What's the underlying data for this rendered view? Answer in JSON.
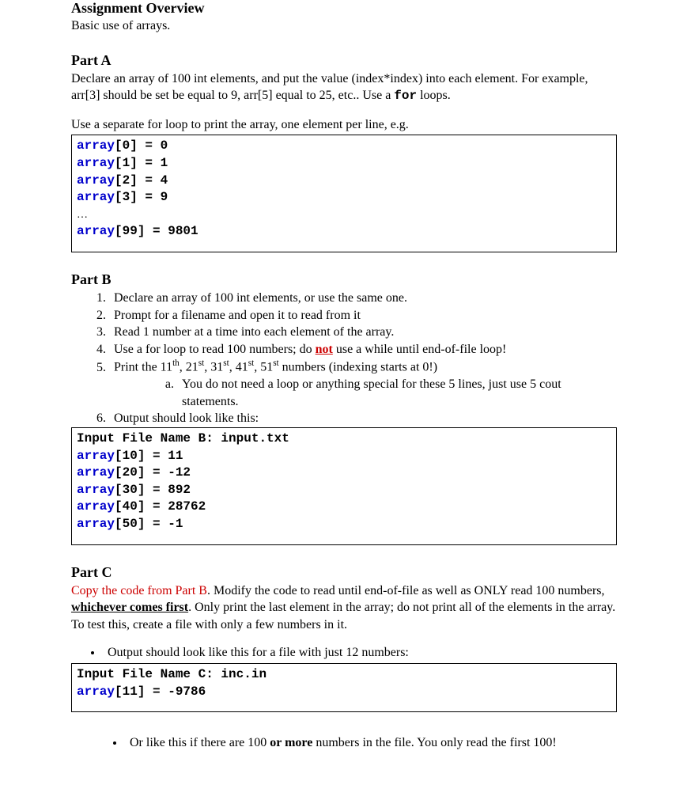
{
  "overview": {
    "title": "Assignment Overview",
    "subtitle": "Basic use of arrays."
  },
  "partA": {
    "heading": "Part A",
    "p1_a": "Declare an array of 100 int elements, and put the value (index*index) into each element. For example, arr[3] should be set be equal to 9, arr[5] equal to 25, etc.. Use a ",
    "p1_mono": "for",
    "p1_b": " loops.",
    "p2": "Use a separate for loop to print the array, one element per line, e.g.",
    "code": {
      "l1a": "array",
      "l1b": "[0] = 0",
      "l2a": "array",
      "l2b": "[1] = 1",
      "l3a": "array",
      "l3b": "[2] = 4",
      "l4a": "array",
      "l4b": "[3] = 9",
      "ell": "…",
      "l5a": "array",
      "l5b": "[99] = 9801"
    }
  },
  "partB": {
    "heading": "Part B",
    "items": {
      "i1": "Declare an array of 100 int elements, or use the same one.",
      "i2": "Prompt for a filename and open it to read from it",
      "i3": "Read 1 number at a time into each element of the array.",
      "i4_a": "Use a for loop to read 100 numbers; do ",
      "i4_not": "not",
      "i4_b": " use a while until end-of-file loop!",
      "i5_a": "Print the 11",
      "i5_th": "th",
      "i5_b": ", 21",
      "i5_st1": "st",
      "i5_c": ", 31",
      "i5_st2": "st",
      "i5_d": ", 41",
      "i5_st3": "st",
      "i5_e": ", 51",
      "i5_st4": "st",
      "i5_f": " numbers (indexing starts at 0!)",
      "i5a": "You do not need a loop or anything special for these 5 lines, just use 5 cout statements.",
      "i6": "Output should look like this:"
    },
    "code": {
      "l1": "Input File Name B: input.txt",
      "l2a": "array",
      "l2b": "[10] = 11",
      "l3a": "array",
      "l3b": "[20] = -12",
      "l4a": "array",
      "l4b": "[30] = 892",
      "l5a": "array",
      "l5b": "[40] = 28762",
      "l6a": "array",
      "l6b": "[50] = -1"
    }
  },
  "partC": {
    "heading": "Part C",
    "p1_red": "Copy the code from Part B",
    "p1_a": ". Modify the code to read until end-of-file as well as ONLY read 100 numbers, ",
    "p1_u": "whichever comes first",
    "p1_b": ". Only print the last element in the array; do not print all of the elements in the array. To test this, create a file with only a few numbers in it.",
    "bullet1": "Output should look like this for a file with just 12 numbers:",
    "code": {
      "l1": "Input File Name C: inc.in",
      "l2a": "array",
      "l2b": "[11] = -9786"
    },
    "bullet2_a": "Or like this if there are 100 ",
    "bullet2_b": "or more",
    "bullet2_c": " numbers in the file. You only read the first 100!"
  }
}
